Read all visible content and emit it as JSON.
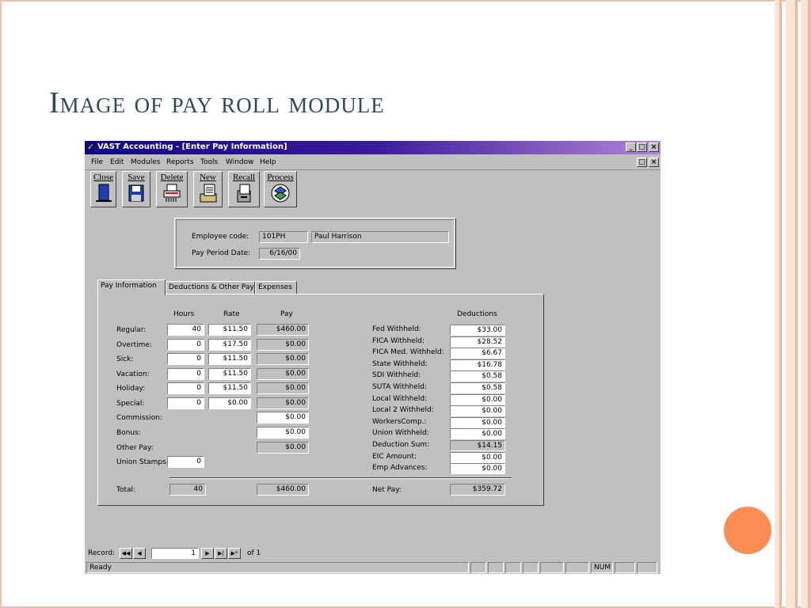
{
  "slide": {
    "title": "Image of pay roll module"
  },
  "window": {
    "title": "VAST Accounting - [Enter Pay Information]",
    "controls": [
      "_",
      "□",
      "×"
    ],
    "child_controls": [
      "□",
      "×"
    ]
  },
  "menu": [
    "File",
    "Edit",
    "Modules",
    "Reports",
    "Tools",
    "Window",
    "Help"
  ],
  "toolbar": {
    "close_label": "Close",
    "save_label": "Save",
    "delete_label": "Delete",
    "new_label": "New",
    "recall_label": "Recall",
    "process_label": "Process"
  },
  "employee": {
    "code_label": "Employee code:",
    "code": "101PH",
    "name": "Paul Harrison",
    "period_label": "Pay Period Date:",
    "period": "6/16/00"
  },
  "tabs": [
    "Pay Information",
    "Deductions & Other Pay",
    "Expenses"
  ],
  "pay": {
    "hours_header": "Hours",
    "rate_header": "Rate",
    "pay_header": "Pay",
    "regular": {
      "label": "Regular:",
      "hours": "40",
      "rate": "$11.50",
      "pay": "$460.00"
    },
    "overtime": {
      "label": "Overtime:",
      "hours": "0",
      "rate": "$17.50",
      "pay": "$0.00"
    },
    "sick": {
      "label": "Sick:",
      "hours": "0",
      "rate": "$11.50",
      "pay": "$0.00"
    },
    "vacation": {
      "label": "Vacation:",
      "hours": "0",
      "rate": "$11.50",
      "pay": "$0.00"
    },
    "holiday": {
      "label": "Holiday:",
      "hours": "0",
      "rate": "$11.50",
      "pay": "$0.00"
    },
    "special": {
      "label": "Special:",
      "hours": "0",
      "rate": "$0.00",
      "pay": "$0.00"
    },
    "commission": {
      "label": "Commission:",
      "pay": "$0.00"
    },
    "bonus": {
      "label": "Bonus:",
      "pay": "$0.00"
    },
    "other_pay": {
      "label": "Other Pay:",
      "pay": "$0.00"
    },
    "union_stamps": {
      "label": "Union Stamps:",
      "hours": "0"
    },
    "total": {
      "label": "Total:",
      "hours": "40",
      "pay": "$460.00"
    }
  },
  "deductions": {
    "header": "Deductions",
    "items": [
      {
        "label": "Fed Withheld:",
        "value": "$33.00"
      },
      {
        "label": "FICA Withheld:",
        "value": "$28.52"
      },
      {
        "label": "FICA Med. Withheld:",
        "value": "$6.67"
      },
      {
        "label": "State Withheld:",
        "value": "$16.78"
      },
      {
        "label": "SDI Withheld:",
        "value": "$0.58"
      },
      {
        "label": "SUTA Withheld:",
        "value": "$0.58"
      },
      {
        "label": "Local Withheld:",
        "value": "$0.00"
      },
      {
        "label": "Local 2 Withheld:",
        "value": "$0.00"
      },
      {
        "label": "WorkersComp.:",
        "value": "$0.00"
      },
      {
        "label": "Union Withheld:",
        "value": "$0.00"
      },
      {
        "label": "Deduction Sum:",
        "value": "$14.15"
      },
      {
        "label": "EIC Amount:",
        "value": "$0.00"
      },
      {
        "label": "Emp Advances:",
        "value": "$0.00"
      }
    ],
    "net_pay_label": "Net Pay:",
    "net_pay": "$359.72"
  },
  "record_nav": {
    "label": "Record:",
    "current": "1",
    "of_label": "of 1"
  },
  "status": {
    "text": "Ready",
    "num": "NUM"
  },
  "colors": {
    "accent": "#fd8c55",
    "title": "#2f4a55",
    "titlebar": "#10087e"
  }
}
